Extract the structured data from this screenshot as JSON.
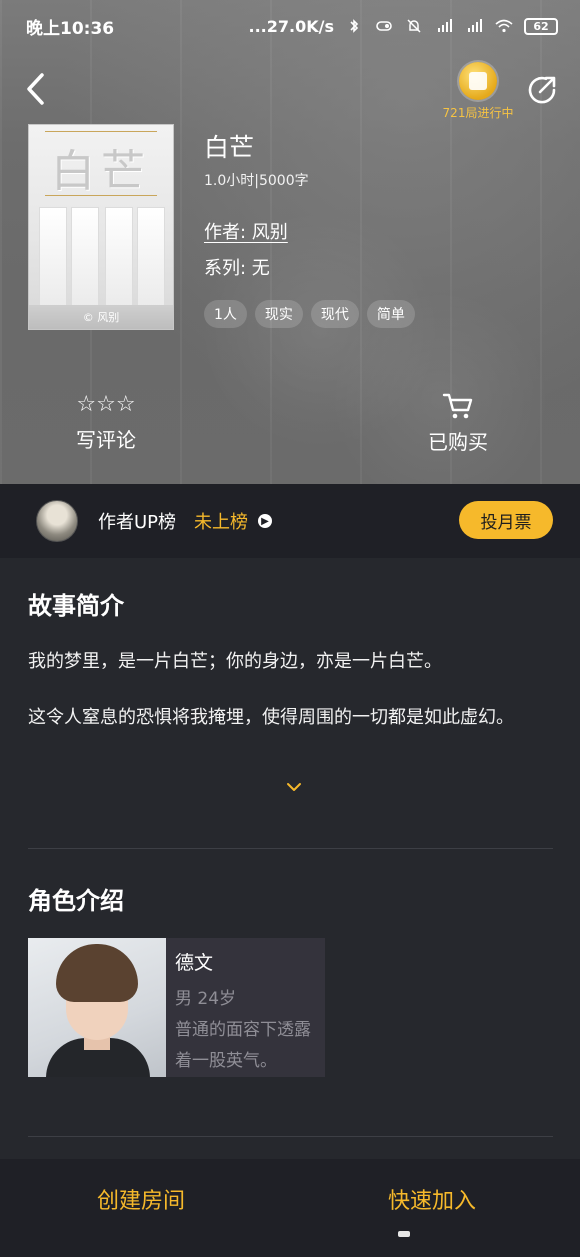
{
  "status_bar": {
    "time": "晚上10:36",
    "network_speed": "...27.0K/s",
    "battery": "62"
  },
  "header": {
    "ongoing_games": "721局进行中"
  },
  "book": {
    "cover_title": "白芒",
    "cover_credit": "© 风别",
    "title": "白芒",
    "meta": "1.0小时|5000字",
    "author": "作者: 风别",
    "series": "系列: 无",
    "tags": [
      "1人",
      "现实",
      "现代",
      "简单"
    ]
  },
  "actions": {
    "review_label": "写评论",
    "stars": "☆☆☆",
    "purchased_label": "已购买"
  },
  "up_rank": {
    "label": "作者UP榜",
    "status": "未上榜",
    "vote_button": "投月票"
  },
  "story": {
    "title": "故事简介",
    "paragraphs": [
      "我的梦里，是一片白芒；你的身边，亦是一片白芒。",
      "这令人窒息的恐惧将我掩埋，使得周围的一切都是如此虚幻。"
    ]
  },
  "characters": {
    "title": "角色介绍",
    "items": [
      {
        "name": "德文",
        "meta": "男  24岁",
        "desc": "普通的面容下透露着一股英气。"
      }
    ]
  },
  "bottom": {
    "create_room": "创建房间",
    "quick_join": "快速加入"
  },
  "colors": {
    "accent": "#f6b92b",
    "background": "#26282d",
    "bar": "#1f2026"
  }
}
